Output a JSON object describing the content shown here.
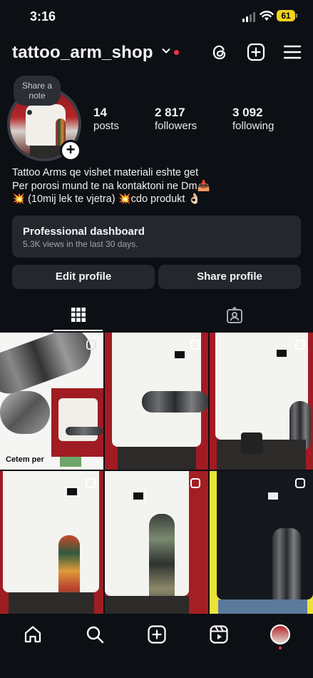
{
  "status": {
    "time": "3:16",
    "battery": "61"
  },
  "header": {
    "username": "tattoo_arm_shop"
  },
  "note": {
    "text": "Share a note"
  },
  "stats": [
    {
      "value": "14",
      "label": "posts"
    },
    {
      "value": "2 817",
      "label": "followers"
    },
    {
      "value": "3 092",
      "label": "following"
    }
  ],
  "bio": {
    "line1": "Tattoo Arms qe vishet materiali eshte get",
    "line2": "Per porosi mund te na kontaktoni ne Dm📥",
    "line3": "💥 (10mij lek te vjetra) 💥cdo produkt 👌🏻"
  },
  "dashboard": {
    "title": "Professional dashboard",
    "subtitle": "5.3K views in the last 30 days."
  },
  "buttons": {
    "edit": "Edit profile",
    "share": "Share profile"
  },
  "posts": {
    "tile1_caption": "Cetem per"
  },
  "colors": {
    "background": "#0c0f14",
    "card": "#24272d",
    "notification": "#ff2d4a",
    "battery": "#f4d21c"
  },
  "icons": [
    "threads-icon",
    "create-icon",
    "menu-icon",
    "grid-icon",
    "tagged-icon",
    "home-icon",
    "search-icon",
    "create-post-icon",
    "reels-icon"
  ]
}
